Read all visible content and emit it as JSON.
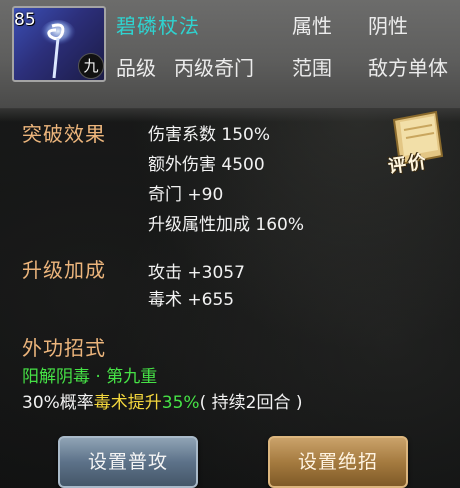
{
  "skill": {
    "level": "85",
    "badge": "九",
    "name": "碧磷杖法"
  },
  "header": {
    "attribute_label": "属性",
    "attribute_value": "阴性",
    "rank_label": "品级",
    "rank_value": "丙级奇门",
    "range_label": "范围",
    "range_value": "敌方单体"
  },
  "breakthrough": {
    "title": "突破效果",
    "lines": [
      "伤害系数 150%",
      "额外伤害 4500",
      "奇门 +90",
      "升级属性加成 160%"
    ]
  },
  "review": {
    "label": "评价"
  },
  "upgrade": {
    "title": "升级加成",
    "lines": [
      "攻击 +3057",
      "毒术 +655"
    ]
  },
  "external": {
    "title": "外功招式",
    "move_name": "阳解阴毒 · 第九重",
    "desc_prefix": "30%概率",
    "desc_gold": "毒术提升",
    "desc_green": "35%",
    "desc_suffix": "( 持续2回合 )"
  },
  "buttons": {
    "set_normal": "设置普攻",
    "set_ultimate": "设置绝招"
  },
  "colors": {
    "skill_name": "#2fd3d0",
    "section_title": "#ecb57c",
    "move_name": "#46e246",
    "highlight_gold": "#f2d63d"
  }
}
